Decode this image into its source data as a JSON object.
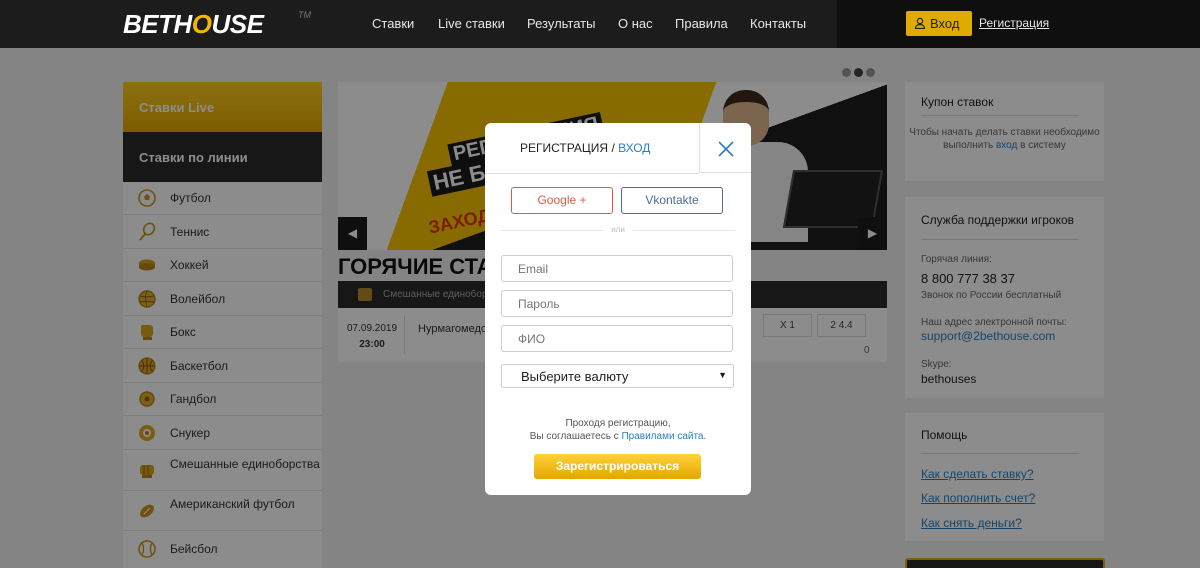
{
  "header": {
    "logo": {
      "part1": "BET",
      "part2": "H",
      "part3": "O",
      "part4": "USE",
      "tm": "TM"
    },
    "nav": [
      "Ставки",
      "Live ставки",
      "Результаты",
      "О нас",
      "Правила",
      "Контакты"
    ],
    "login_label": "Вход",
    "register_label": "Регистрация"
  },
  "sidebar": {
    "live_label": "Ставки Live",
    "line_label": "Ставки по линии",
    "items": [
      {
        "label": "Футбол",
        "icon": "football-icon"
      },
      {
        "label": "Теннис",
        "icon": "tennis-icon"
      },
      {
        "label": "Хоккей",
        "icon": "hockey-icon"
      },
      {
        "label": "Волейбол",
        "icon": "volleyball-icon"
      },
      {
        "label": "Бокс",
        "icon": "boxing-icon"
      },
      {
        "label": "Баскетбол",
        "icon": "basketball-icon"
      },
      {
        "label": "Гандбол",
        "icon": "handball-icon"
      },
      {
        "label": "Снукер",
        "icon": "snooker-icon"
      },
      {
        "label": "Смешанные единоборства",
        "icon": "mma-icon"
      },
      {
        "label": "Американский футбол",
        "icon": "american-football-icon"
      },
      {
        "label": "Бейсбол",
        "icon": "baseball-icon"
      }
    ]
  },
  "banner": {
    "line1": "РЕГИСТРАЦИЯ",
    "line2": "НЕ БОЛЬШЕ",
    "line3": "НЕ НУЖНА",
    "line4": "ЗАХОДИ"
  },
  "hot": {
    "title": "ГОРЯЧИЕ СТАВКИ",
    "category": "Смешанные единоборства",
    "date": "07.09.2019",
    "time": "23:00",
    "match": "Нурмагомедов",
    "odd1": "Х  1",
    "odd2": "2  4.4",
    "extra": "0"
  },
  "coupon": {
    "title": "Купон ставок",
    "text_before": "Чтобы начать делать ставки необходимо выполнить",
    "link": "вход",
    "text_after": "в систему"
  },
  "support": {
    "title": "Служба поддержки игроков",
    "hotline_label": "Горячая линия:",
    "phone": "8 800 777 38 37",
    "phone_note": "Звонок по России бесплатный",
    "email_label": "Наш адрес электронной почты:",
    "email": "support@2bethouse.com",
    "skype_label": "Skype:",
    "skype": "bethouses"
  },
  "help": {
    "title": "Помощь",
    "links": [
      "Как сделать ставку?",
      "Как пополнить счет?",
      "Как снять деньги?"
    ]
  },
  "modal": {
    "title_register": "РЕГИСТРАЦИЯ",
    "title_sep": "/",
    "title_login": "ВХОД",
    "google": "Google +",
    "vk": "Vkontakte",
    "or": "или",
    "email_placeholder": "Email",
    "password_placeholder": "Пароль",
    "fio_placeholder": "ФИО",
    "currency": "Выберите валюту",
    "agree_line1": "Проходя регистрацию,",
    "agree_line2": "Вы соглашаетесь с",
    "agree_link": "Правилами сайта",
    "agree_end": ".",
    "submit": "Зарегистрироваться"
  }
}
